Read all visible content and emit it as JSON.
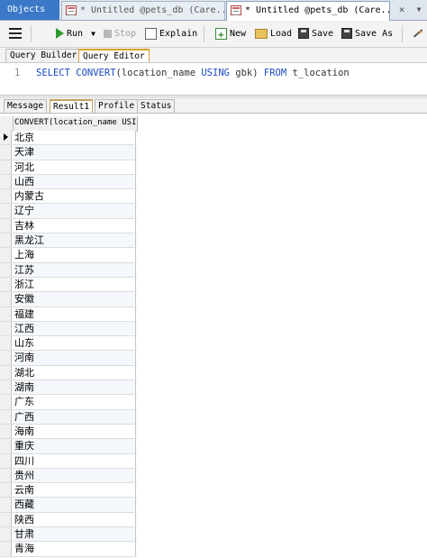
{
  "tabs": {
    "objects": "Objects",
    "doc1": "* Untitled @pets_db (Care...",
    "doc2": "* Untitled @pets_db (Care..."
  },
  "toolbar": {
    "run": "Run",
    "stop": "Stop",
    "explain": "Explain",
    "new": "New",
    "load": "Load",
    "save": "Save",
    "save_as": "Save As"
  },
  "editor_tabs": [
    "Query Builder",
    "Query Editor"
  ],
  "editor": {
    "line_number": "1",
    "sql_parts": {
      "select": "SELECT",
      "convert": "CONVERT",
      "arg1": "(location_name ",
      "using": "USING",
      "arg2": " gbk) ",
      "from": "FROM",
      "table": " t_location"
    }
  },
  "result_tabs": [
    "Message",
    "Result1",
    "Profile",
    "Status"
  ],
  "grid": {
    "column_header": "CONVERT(location_name USI",
    "rows": [
      "北京",
      "天津",
      "河北",
      "山西",
      "内蒙古",
      "辽宁",
      "吉林",
      "黑龙江",
      "上海",
      "江苏",
      "浙江",
      "安徽",
      "福建",
      "江西",
      "山东",
      "河南",
      "湖北",
      "湖南",
      "广东",
      "广西",
      "海南",
      "重庆",
      "四川",
      "贵州",
      "云南",
      "西藏",
      "陕西",
      "甘肃",
      "青海"
    ]
  },
  "colors": {
    "objects_tab_bg": "#3b78c8",
    "keyword_blue": "#1a4bc4",
    "active_tab_accent": "#e0a030",
    "run_green": "#2e9a2e"
  }
}
